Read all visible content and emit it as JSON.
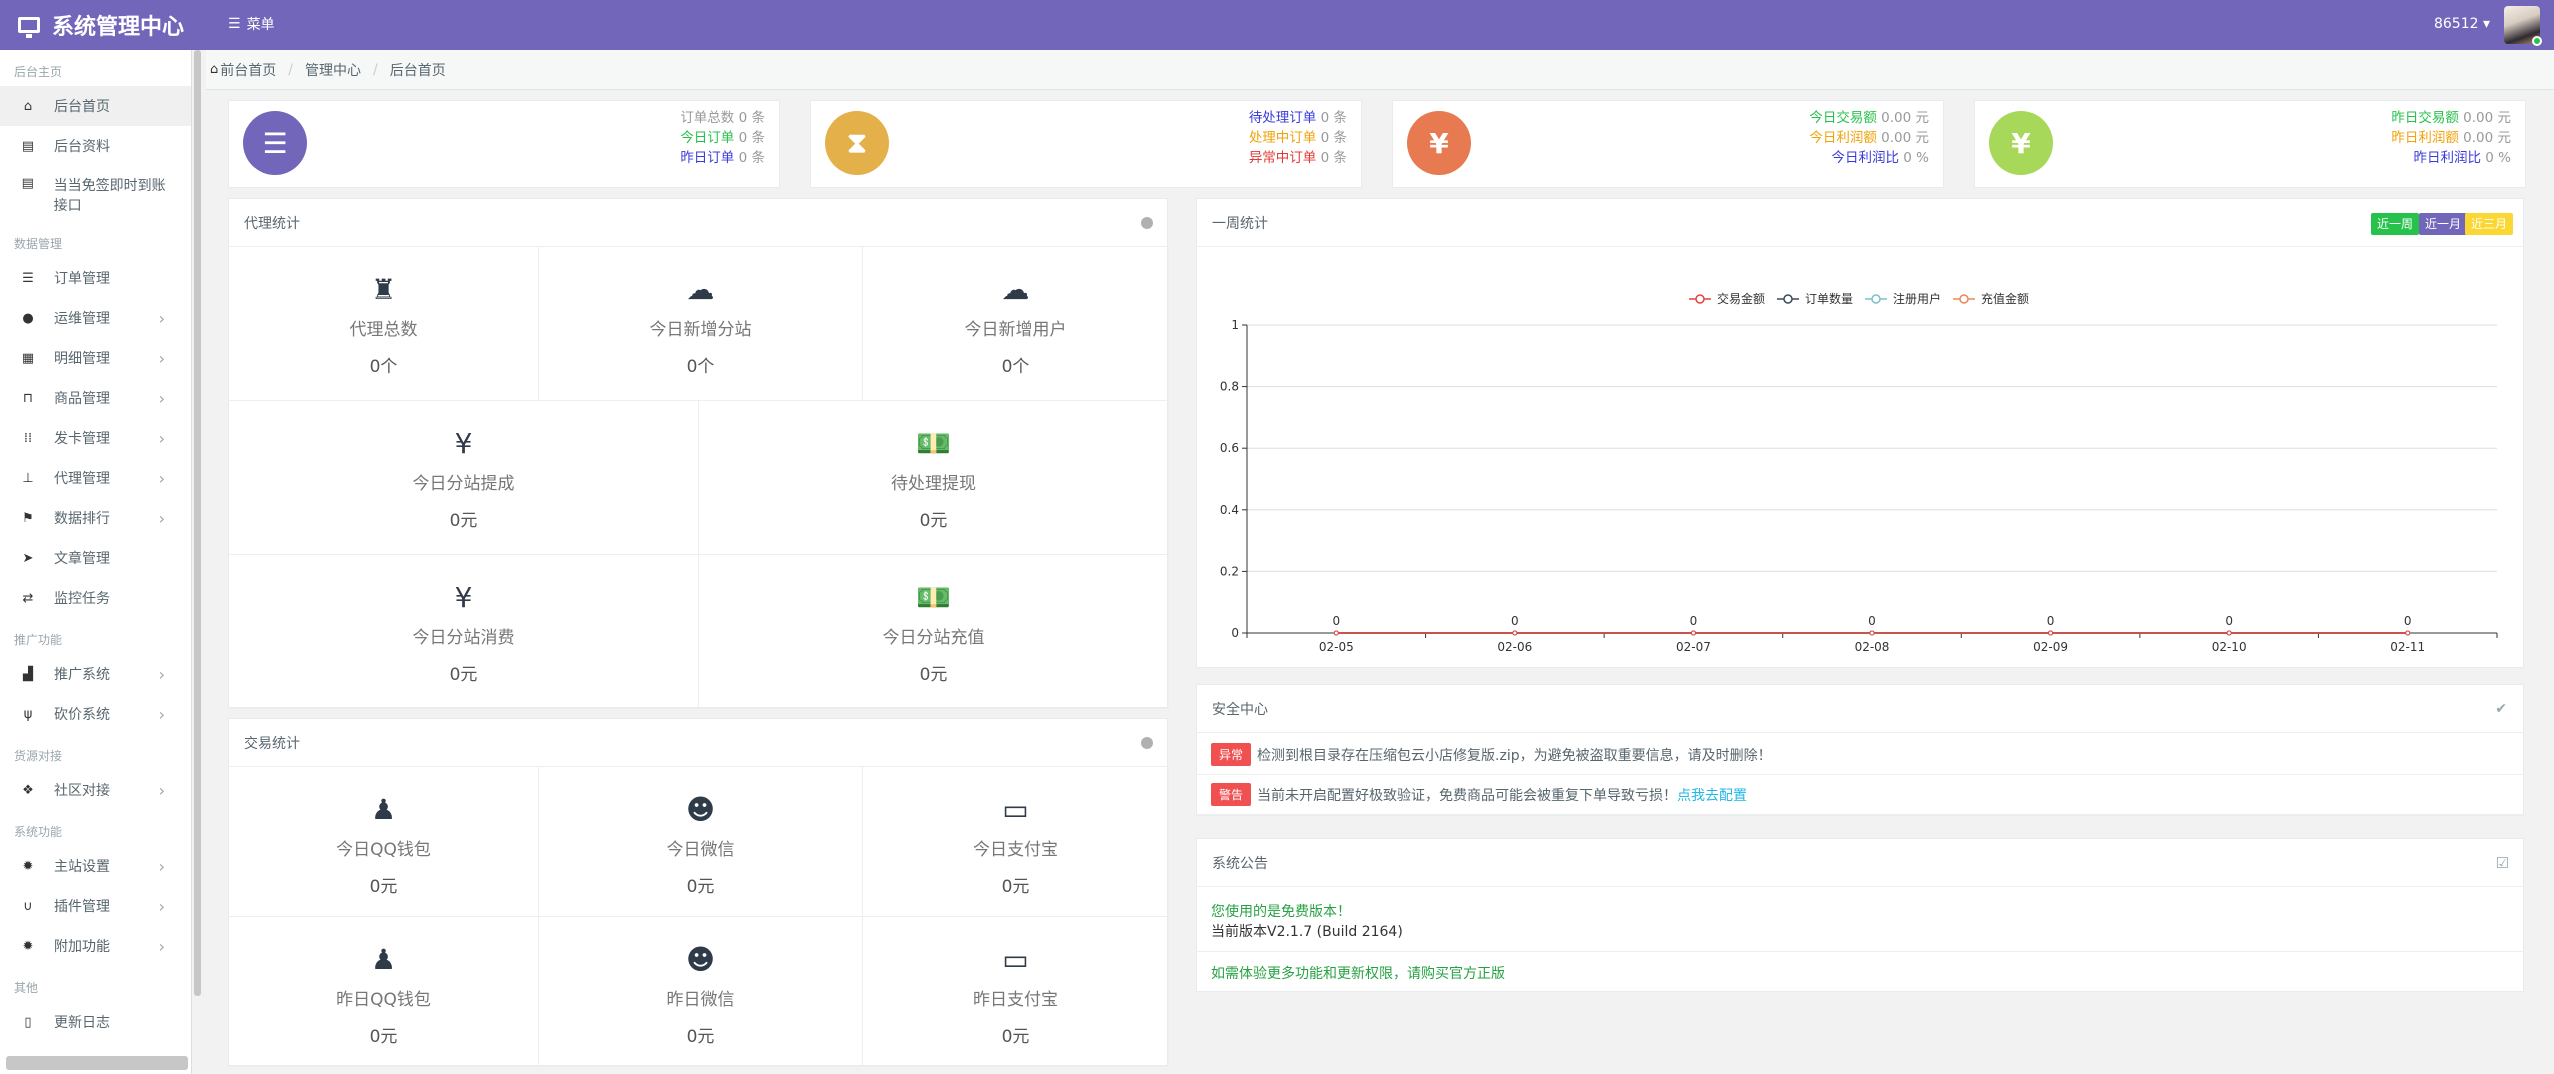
{
  "header": {
    "title": "系统管理中心",
    "menu_label": "菜单",
    "username": "86512",
    "caret": "▾"
  },
  "sidebar": {
    "groups": [
      {
        "title": "后台主页",
        "items": [
          {
            "icon": "home-icon",
            "glyph": "⌂",
            "label": "后台首页",
            "active": true
          },
          {
            "icon": "id-card-icon",
            "glyph": "▤",
            "label": "后台资料"
          },
          {
            "icon": "id-card-icon",
            "glyph": "▤",
            "label": "当当免签即时到账接口",
            "multiline": true
          }
        ]
      },
      {
        "title": "数据管理",
        "items": [
          {
            "icon": "list-icon",
            "glyph": "☰",
            "label": "订单管理"
          },
          {
            "icon": "comments-icon",
            "glyph": "●",
            "label": "运维管理",
            "arrow": true
          },
          {
            "icon": "calendar-icon",
            "glyph": "▦",
            "label": "明细管理",
            "arrow": true
          },
          {
            "icon": "cart-icon",
            "glyph": "⊓",
            "label": "商品管理",
            "arrow": true
          },
          {
            "icon": "grid-icon",
            "glyph": "⁞⁞",
            "label": "发卡管理",
            "arrow": true
          },
          {
            "icon": "sitemap-icon",
            "glyph": "⊥",
            "label": "代理管理",
            "arrow": true
          },
          {
            "icon": "flag-icon",
            "glyph": "⚑",
            "label": "数据排行",
            "arrow": true
          },
          {
            "icon": "paper-plane-icon",
            "glyph": "➤",
            "label": "文章管理"
          },
          {
            "icon": "retweet-icon",
            "glyph": "⇄",
            "label": "监控任务"
          }
        ]
      },
      {
        "title": "推广功能",
        "items": [
          {
            "icon": "industry-icon",
            "glyph": "▟",
            "label": "推广系统",
            "arrow": true
          },
          {
            "icon": "cutlery-icon",
            "glyph": "ψ",
            "label": "砍价系统",
            "arrow": true
          }
        ]
      },
      {
        "title": "货源对接",
        "items": [
          {
            "icon": "cubes-icon",
            "glyph": "❖",
            "label": "社区对接",
            "arrow": true
          }
        ]
      },
      {
        "title": "系统功能",
        "items": [
          {
            "icon": "gear-icon",
            "glyph": "✹",
            "label": "主站设置",
            "arrow": true
          },
          {
            "icon": "magnet-icon",
            "glyph": "∪",
            "label": "插件管理",
            "arrow": true
          },
          {
            "icon": "gears-icon",
            "glyph": "✹",
            "label": "附加功能",
            "arrow": true
          }
        ]
      },
      {
        "title": "其他",
        "items": [
          {
            "icon": "file-icon",
            "glyph": "▯",
            "label": "更新日志"
          }
        ]
      }
    ]
  },
  "breadcrumb": {
    "items": [
      "前台首页",
      "管理中心",
      "后台首页"
    ],
    "sep": "/"
  },
  "stat_cards": [
    {
      "color": "#7266ba",
      "glyph": "☰",
      "rows": [
        {
          "label": "订单总数",
          "color": "#999",
          "value": "0 条"
        },
        {
          "label": "今日订单",
          "color": "#27c24c",
          "value": "0 条"
        },
        {
          "label": "昨日订单",
          "color": "#3b3bdb",
          "value": "0 条"
        }
      ]
    },
    {
      "color": "#e4b04a",
      "glyph": "⧗",
      "rows": [
        {
          "label": "待处理订单",
          "color": "#3b3bdb",
          "value": "0 条"
        },
        {
          "label": "处理中订单",
          "color": "#f0a30a",
          "value": "0 条"
        },
        {
          "label": "异常中订单",
          "color": "#e53935",
          "value": "0 条"
        }
      ]
    },
    {
      "color": "#e77a50",
      "glyph": "¥",
      "rows": [
        {
          "label": "今日交易额",
          "color": "#27c24c",
          "value": "0.00 元"
        },
        {
          "label": "今日利润额",
          "color": "#f0a30a",
          "value": "0.00 元"
        },
        {
          "label": "今日利润比",
          "color": "#3b3bdb",
          "value": "0 %"
        }
      ]
    },
    {
      "color": "#a8d859",
      "glyph": "¥",
      "rows": [
        {
          "label": "昨日交易额",
          "color": "#27c24c",
          "value": "0.00 元"
        },
        {
          "label": "昨日利润额",
          "color": "#f0a30a",
          "value": "0.00 元"
        },
        {
          "label": "昨日利润比",
          "color": "#3b3bdb",
          "value": "0 %"
        }
      ]
    }
  ],
  "agent_stats": {
    "title": "代理统计",
    "cells": [
      {
        "glyph": "♜",
        "icon": "sitemap-icon",
        "label": "代理总数",
        "value": "0个"
      },
      {
        "glyph": "☁",
        "icon": "cloud-icon",
        "label": "今日新增分站",
        "value": "0个"
      },
      {
        "glyph": "☁",
        "icon": "cloud-icon",
        "label": "今日新增用户",
        "value": "0个"
      },
      {
        "glyph": "¥",
        "icon": "yen-icon",
        "label": "今日分站提成",
        "value": "0元"
      },
      {
        "glyph": "💵",
        "icon": "money-icon",
        "label": "待处理提现",
        "value": "0元"
      },
      {
        "glyph": "¥",
        "icon": "yen-icon",
        "label": "今日分站消费",
        "value": "0元"
      },
      {
        "glyph": "💵",
        "icon": "money-icon",
        "label": "今日分站充值",
        "value": "0元"
      }
    ]
  },
  "trade_stats": {
    "title": "交易统计",
    "cells": [
      {
        "glyph": "♟",
        "icon": "qq-icon",
        "label": "今日QQ钱包",
        "value": "0元"
      },
      {
        "glyph": "☻",
        "icon": "wechat-icon",
        "label": "今日微信",
        "value": "0元"
      },
      {
        "glyph": "▭",
        "icon": "credit-card-icon",
        "label": "今日支付宝",
        "value": "0元"
      },
      {
        "glyph": "♟",
        "icon": "qq-icon",
        "label": "昨日QQ钱包",
        "value": "0元"
      },
      {
        "glyph": "☻",
        "icon": "wechat-icon",
        "label": "昨日微信",
        "value": "0元"
      },
      {
        "glyph": "▭",
        "icon": "credit-card-icon",
        "label": "昨日支付宝",
        "value": "0元"
      }
    ]
  },
  "weekly": {
    "title": "一周统计",
    "buttons": [
      {
        "label": "近一周",
        "color": "#27c24c"
      },
      {
        "label": "近一月",
        "color": "#7266ba"
      },
      {
        "label": "近三月",
        "color": "#fad733"
      }
    ]
  },
  "chart_data": {
    "type": "line",
    "x": [
      "02-05",
      "02-06",
      "02-07",
      "02-08",
      "02-09",
      "02-10",
      "02-11"
    ],
    "series": [
      {
        "name": "交易金额",
        "color": "#e0443e",
        "values": [
          0,
          0,
          0,
          0,
          0,
          0,
          0
        ]
      },
      {
        "name": "订单数量",
        "color": "#3a4a5c",
        "values": [
          0,
          0,
          0,
          0,
          0,
          0,
          0
        ]
      },
      {
        "name": "注册用户",
        "color": "#7fbfc9",
        "values": [
          0,
          0,
          0,
          0,
          0,
          0,
          0
        ]
      },
      {
        "name": "充值金额",
        "color": "#e58a5a",
        "values": [
          0,
          0,
          0,
          0,
          0,
          0,
          0
        ]
      }
    ],
    "ylim": [
      0,
      1
    ],
    "yticks": [
      "0",
      "0.2",
      "0.4",
      "0.6",
      "0.8",
      "1"
    ],
    "ytick_values": [
      0,
      0.2,
      0.4,
      0.6,
      0.8,
      1
    ],
    "data_labels": [
      "0",
      "0",
      "0",
      "0",
      "0",
      "0",
      "0"
    ],
    "legend": "top-center",
    "grid": true
  },
  "security": {
    "title": "安全中心",
    "alerts": [
      {
        "tag": "异常",
        "text": "检测到根目录存在压缩包云小店修复版.zip，为避免被盗取重要信息，请及时删除！",
        "link": ""
      },
      {
        "tag": "警告",
        "text": "当前未开启配置好极致验证，免费商品可能会被重复下单导致亏损！",
        "link": "点我去配置"
      }
    ]
  },
  "announce": {
    "title": "系统公告",
    "line1": "您使用的是免费版本！",
    "line2": "当前版本V2.1.7 (Build 2164)",
    "line3": "如需体验更多功能和更新权限，请购买官方正版"
  }
}
